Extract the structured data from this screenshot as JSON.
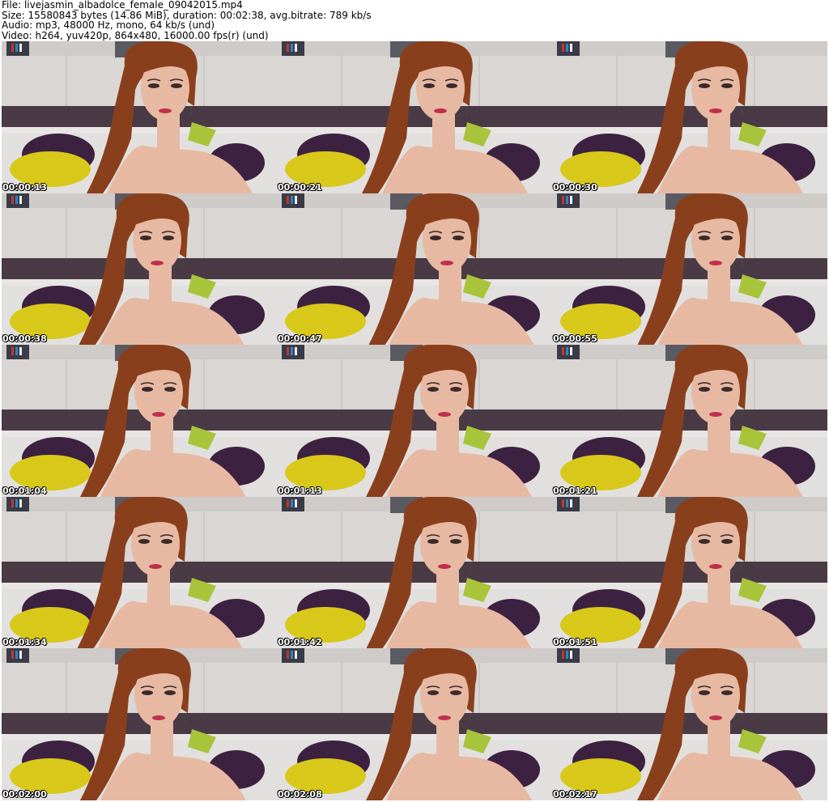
{
  "header": {
    "line1": "File: livejasmin_albadolce_female_09042015.mp4",
    "line2": "Size: 15580843 bytes (14.86 MiB), duration: 00:02:38, avg.bitrate: 789 kb/s",
    "line3": "Audio: mp3, 48000 Hz, mono, 64 kb/s (und)",
    "line4": "Video: h264, yuv420p, 864x480, 16000.00 fps(r) (und)"
  },
  "frames": [
    {
      "timestamp": "00:00:13"
    },
    {
      "timestamp": "00:00:21"
    },
    {
      "timestamp": "00:00:30"
    },
    {
      "timestamp": "00:00:38"
    },
    {
      "timestamp": "00:00:47"
    },
    {
      "timestamp": "00:00:55"
    },
    {
      "timestamp": "00:01:04"
    },
    {
      "timestamp": "00:01:13"
    },
    {
      "timestamp": "00:01:21"
    },
    {
      "timestamp": "00:01:34"
    },
    {
      "timestamp": "00:01:42"
    },
    {
      "timestamp": "00:01:51"
    },
    {
      "timestamp": "00:02:00"
    },
    {
      "timestamp": "00:02:08"
    },
    {
      "timestamp": "00:02:17"
    }
  ],
  "colors": {
    "wall": "#d9d6d3",
    "headboard_stripe": "#4a3a45",
    "pillow_yellow": "#d8c81a",
    "pillow_purple": "#3d2140",
    "pillow_green": "#a8c43a",
    "hair": "#8a3f1c",
    "skin": "#e7b9a3"
  }
}
